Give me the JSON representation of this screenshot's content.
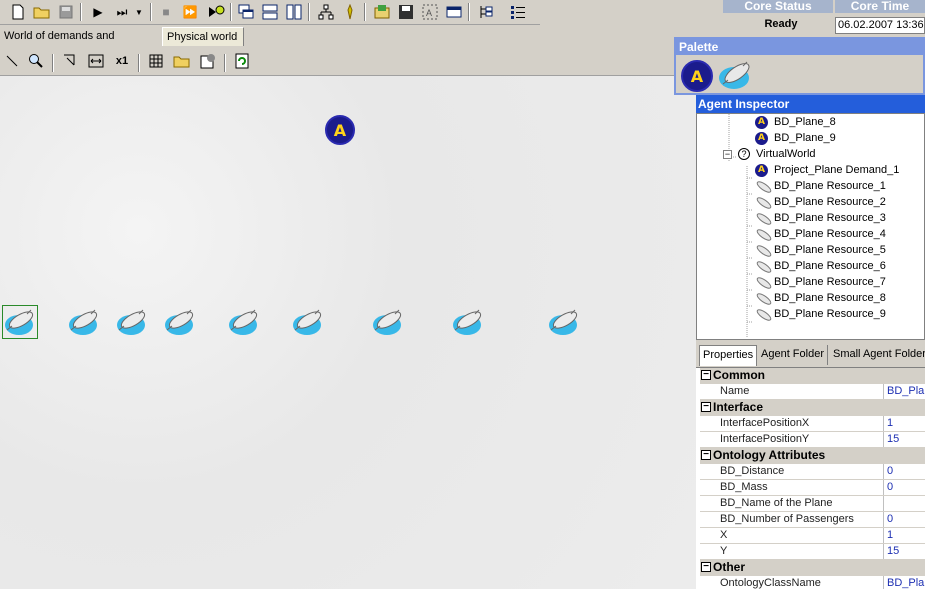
{
  "status": {
    "core_status_header": "Core Status",
    "core_time_header": "Core Time",
    "core_status_value": "Ready",
    "core_time_value": "06.02.2007 13:36:"
  },
  "tabs": [
    "World of demands and resources",
    "Physical world"
  ],
  "toolbar2": {
    "zoom_label": "x1"
  },
  "palette": {
    "title": "Palette"
  },
  "inspector": {
    "title": "Agent Inspector",
    "tree": [
      {
        "label": "BD_Plane_8",
        "icon": "agent-a"
      },
      {
        "label": "BD_Plane_9",
        "icon": "agent-a"
      },
      {
        "label": "VirtualWorld",
        "icon": "question"
      },
      {
        "label": "Project_Plane Demand_1",
        "icon": "agent-a"
      },
      {
        "label": "BD_Plane Resource_1",
        "icon": "plane"
      },
      {
        "label": "BD_Plane Resource_2",
        "icon": "plane"
      },
      {
        "label": "BD_Plane Resource_3",
        "icon": "plane"
      },
      {
        "label": "BD_Plane Resource_4",
        "icon": "plane"
      },
      {
        "label": "BD_Plane Resource_5",
        "icon": "plane"
      },
      {
        "label": "BD_Plane Resource_6",
        "icon": "plane"
      },
      {
        "label": "BD_Plane Resource_7",
        "icon": "plane"
      },
      {
        "label": "BD_Plane Resource_8",
        "icon": "plane"
      },
      {
        "label": "BD_Plane Resource_9",
        "icon": "plane"
      }
    ],
    "prop_tabs": [
      "Properties",
      "Agent Folder",
      "Small Agent Folder"
    ],
    "properties": [
      {
        "category": "Common"
      },
      {
        "name": "Name",
        "value": "BD_Pla"
      },
      {
        "category": "Interface"
      },
      {
        "name": "InterfacePositionX",
        "value": "1"
      },
      {
        "name": "InterfacePositionY",
        "value": "15"
      },
      {
        "category": "Ontology Attributes"
      },
      {
        "name": "BD_Distance",
        "value": "0"
      },
      {
        "name": "BD_Mass",
        "value": "0"
      },
      {
        "name": "BD_Name of the Plane",
        "value": ""
      },
      {
        "name": "BD_Number of Passengers",
        "value": "0"
      },
      {
        "name": "X",
        "value": "1"
      },
      {
        "name": "Y",
        "value": "15"
      },
      {
        "category": "Other"
      },
      {
        "name": "OntologyClassName",
        "value": "BD_Pla"
      }
    ]
  },
  "canvas": {
    "agent_letter": "A"
  }
}
